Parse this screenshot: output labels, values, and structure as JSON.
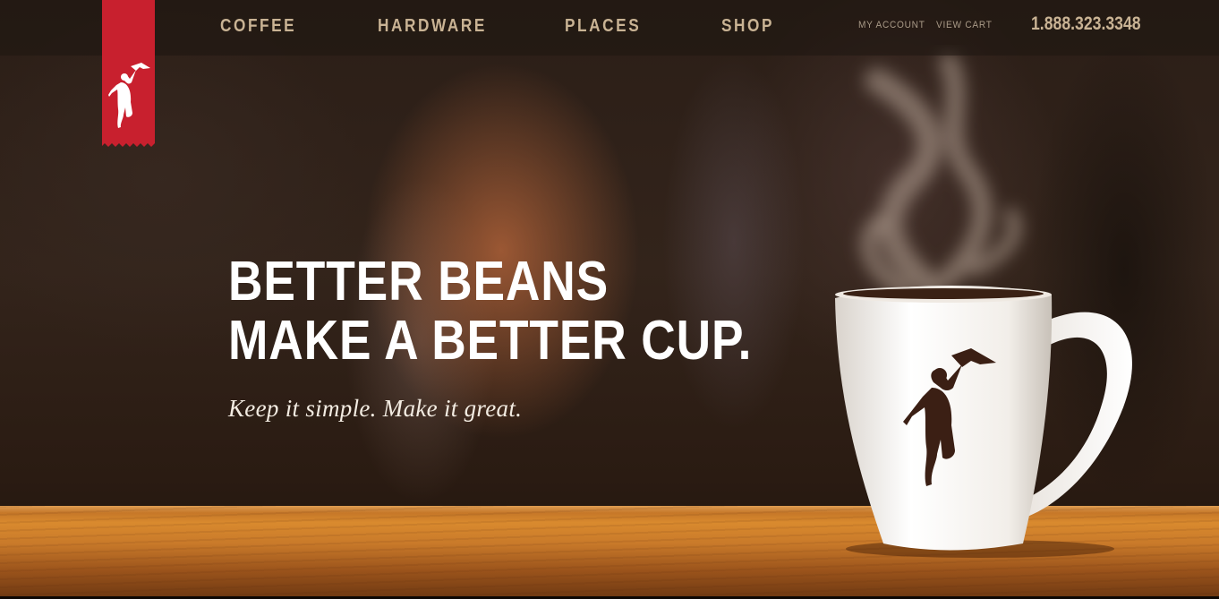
{
  "header": {
    "nav": [
      {
        "label": "COFFEE"
      },
      {
        "label": "HARDWARE"
      },
      {
        "label": "PLACES"
      },
      {
        "label": "SHOP"
      }
    ],
    "utility": {
      "account_label": "MY ACCOUNT",
      "cart_label": "VIEW CART"
    },
    "phone": "1.888.323.3348"
  },
  "logo": {
    "icon": "boy-with-airplane-icon",
    "ribbon_color": "#c8202e"
  },
  "hero": {
    "headline_line1": "BETTER BEANS",
    "headline_line2": "MAKE A BETTER CUP.",
    "tagline": "Keep it simple. Make it great.",
    "mug_icon": "coffee-mug-icon",
    "steam_icon": "steam-icon"
  },
  "colors": {
    "nav_text": "#c9b394",
    "headline_text": "#ffffff",
    "brand_red": "#c8202e"
  }
}
